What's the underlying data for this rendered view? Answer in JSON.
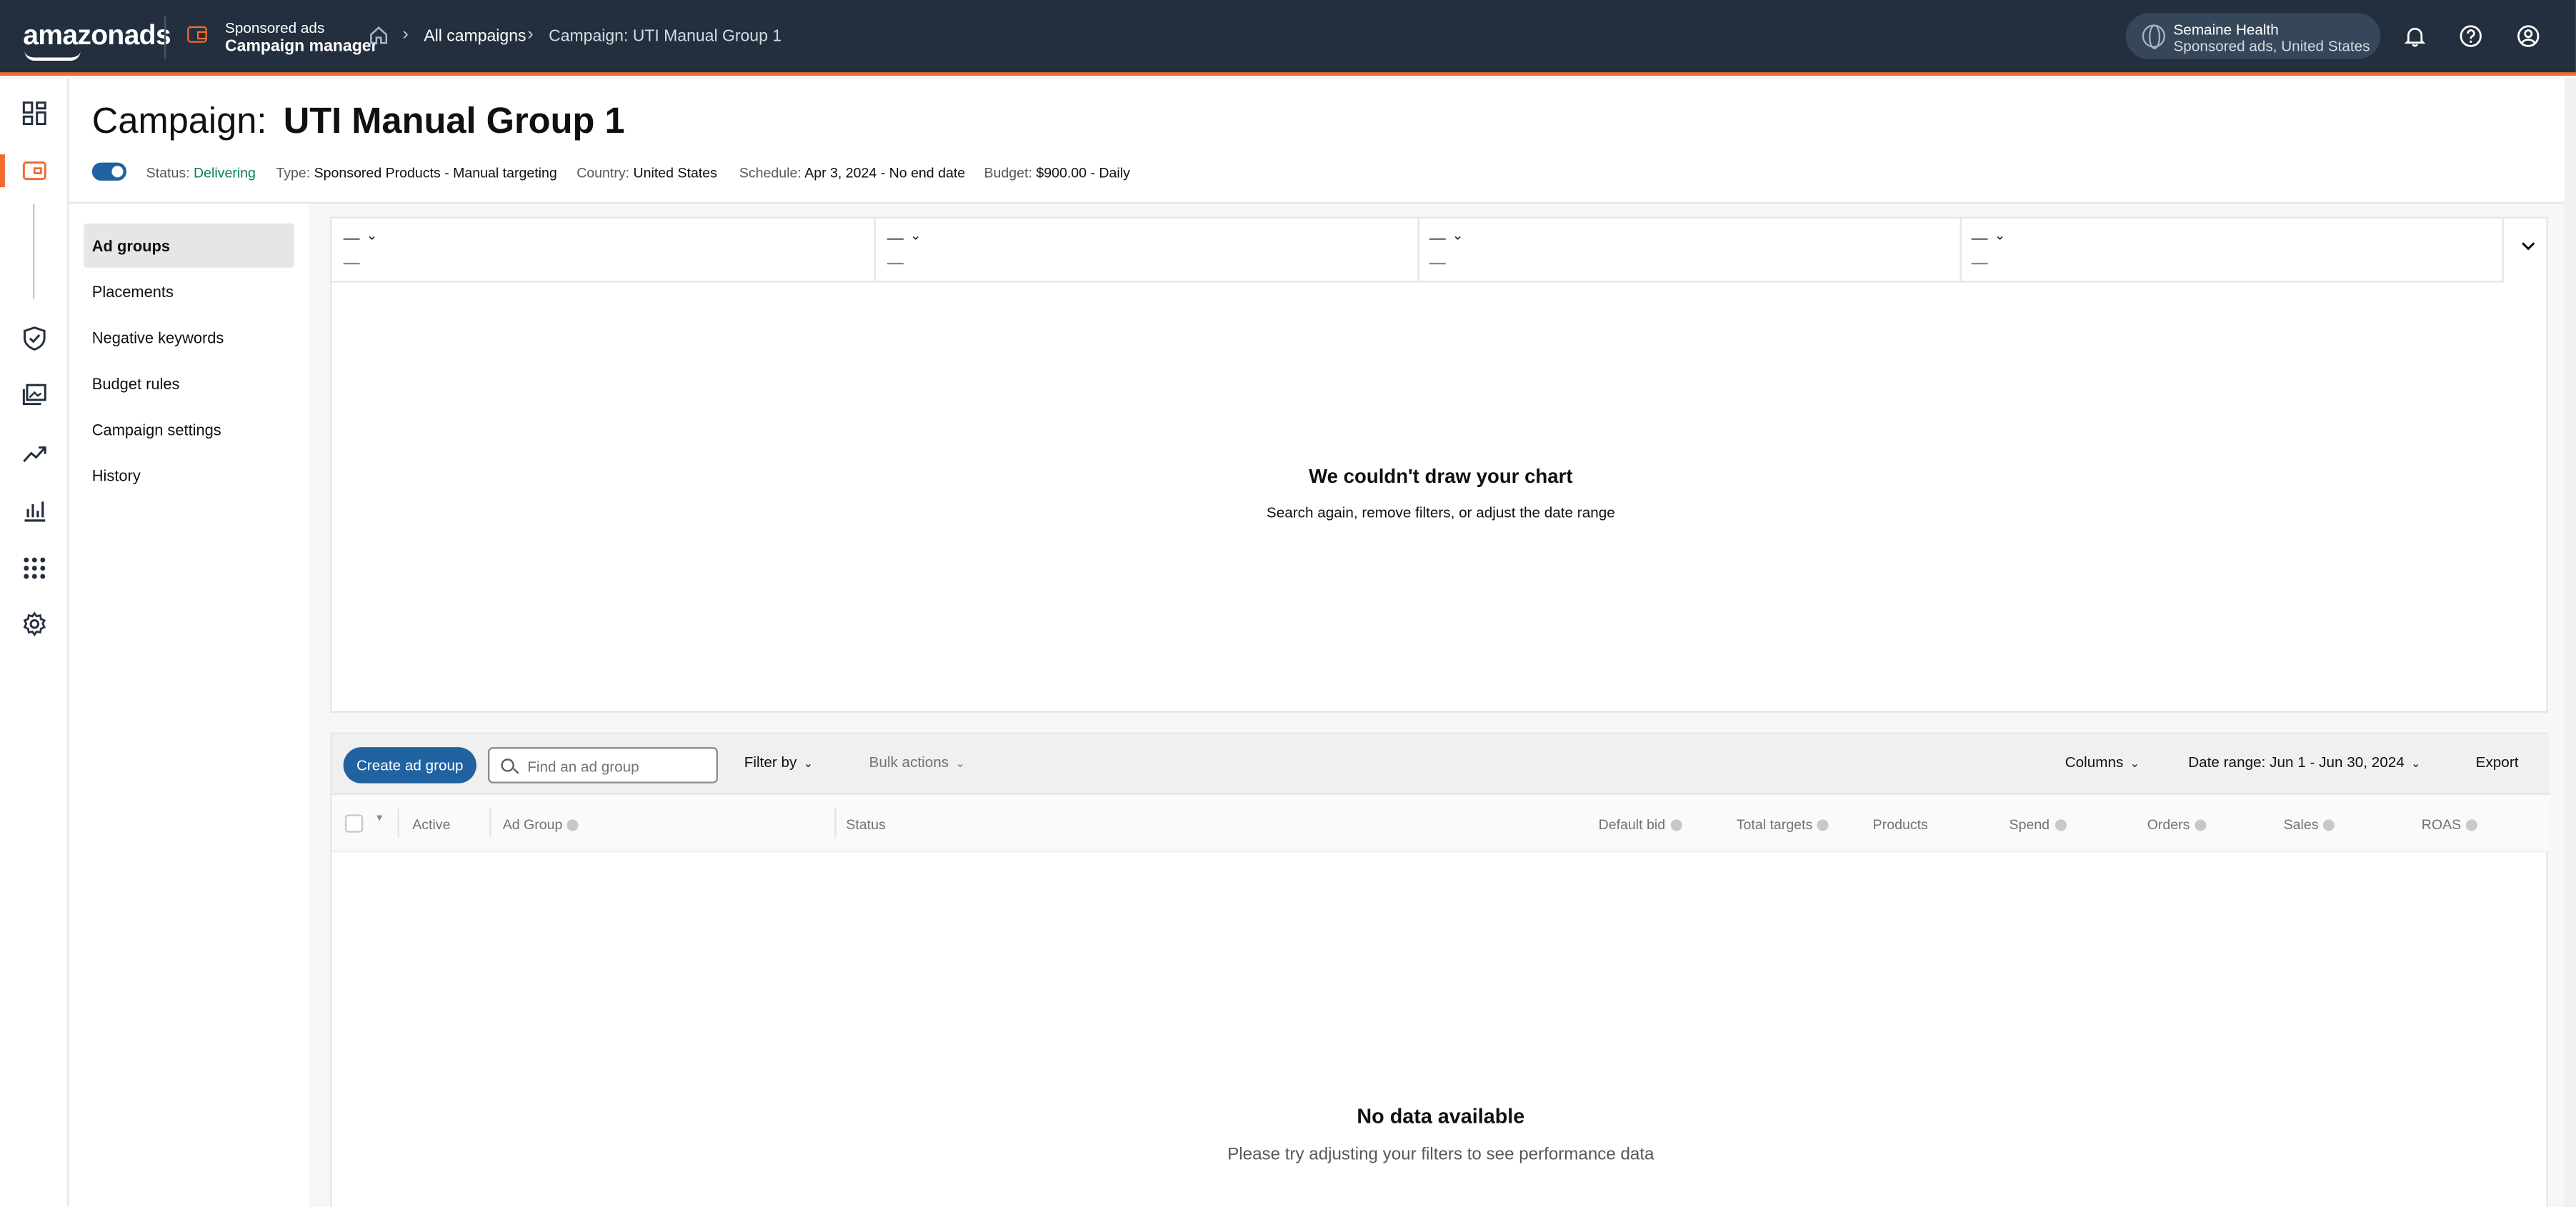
{
  "topbar": {
    "logo": "amazonads",
    "app_line1": "Sponsored ads",
    "app_line2": "Campaign manager",
    "breadcrumb": [
      "All campaigns",
      "Campaign: UTI Manual Group 1"
    ],
    "account_name": "Semaine Health",
    "account_sub": "Sponsored ads, United States"
  },
  "header": {
    "title_prefix": "Campaign:",
    "title_name": "UTI Manual Group 1",
    "status_label": "Status:",
    "status_value": "Delivering",
    "type_label": "Type:",
    "type_value": "Sponsored Products - Manual targeting",
    "country_label": "Country:",
    "country_value": "United States",
    "schedule_label": "Schedule:",
    "schedule_value": "Apr 3, 2024 - No end date",
    "budget_label": "Budget:",
    "budget_value": "$900.00 - Daily"
  },
  "subnav": {
    "items": [
      "Ad groups",
      "Placements",
      "Negative keywords",
      "Budget rules",
      "Campaign settings",
      "History"
    ],
    "active": "Ad groups"
  },
  "chart": {
    "metrics": [
      "—",
      "—",
      "—",
      "—"
    ],
    "empty_title": "We couldn't draw your chart",
    "empty_sub": "Search again, remove filters, or adjust the date range"
  },
  "table": {
    "create_label": "Create ad group",
    "search_placeholder": "Find an ad group",
    "filter_label": "Filter by",
    "bulk_label": "Bulk actions",
    "columns_label": "Columns",
    "date_range_label": "Date range: Jun 1 - Jun 30, 2024",
    "export_label": "Export",
    "headers": [
      "Active",
      "Ad Group",
      "Status",
      "Default bid",
      "Total targets",
      "Products",
      "Spend",
      "Orders",
      "Sales",
      "ROAS"
    ],
    "nodata_title": "No data available",
    "nodata_sub": "Please try adjusting your filters to see performance data"
  },
  "colors": {
    "topbar": "#232f3e",
    "accent": "#f26a2e",
    "primary": "#2162a1",
    "status_green": "#067d62"
  }
}
